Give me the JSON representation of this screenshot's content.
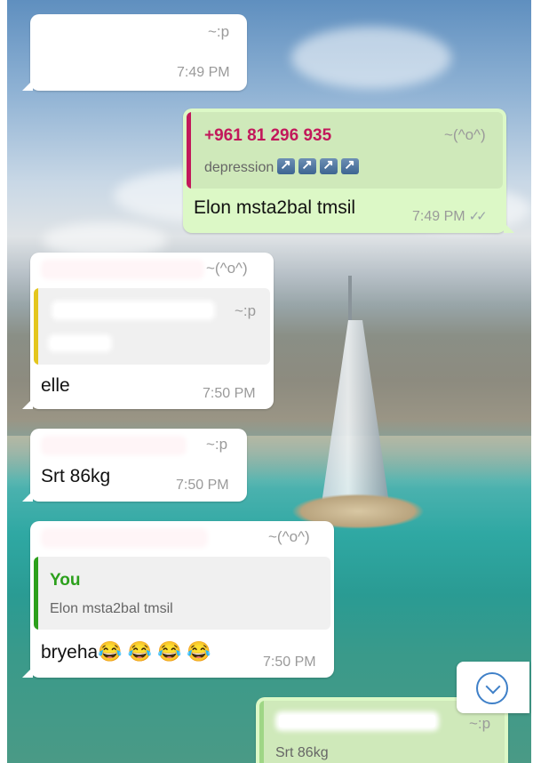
{
  "messages": [
    {
      "tilde": "~:p",
      "time": "7:49 PM"
    },
    {
      "quote": {
        "name": "+961 81 296 935",
        "tilde": "~(^o^)",
        "text": "depression"
      },
      "text": "Elon msta2bal tmsil",
      "time": "7:49 PM",
      "ticks": "✓✓"
    },
    {
      "tilde": "~(^o^)",
      "quote": {
        "tilde": "~:p"
      },
      "text": "elle",
      "time": "7:50 PM"
    },
    {
      "tilde": "~:p",
      "text": "Srt 86kg",
      "time": "7:50 PM"
    },
    {
      "tilde": "~(^o^)",
      "quote": {
        "name": "You",
        "text": "Elon msta2bal tmsil"
      },
      "text": "bryeha",
      "emoji": "😂😂😂😂",
      "time": "7:50 PM"
    },
    {
      "tilde": "~:p",
      "text": "Srt 86kg"
    }
  ],
  "colors": {
    "outgoing_bubble": "#dcf8c6",
    "incoming_bubble": "#ffffff",
    "quote_pink": "#c2185b",
    "quote_yellow": "#e4c61e",
    "quote_green": "#2ca01c",
    "accent_blue": "#3f80c8"
  },
  "icons": {
    "arrows": "arrow-up-right-icon",
    "scroll": "scroll-down-icon"
  }
}
